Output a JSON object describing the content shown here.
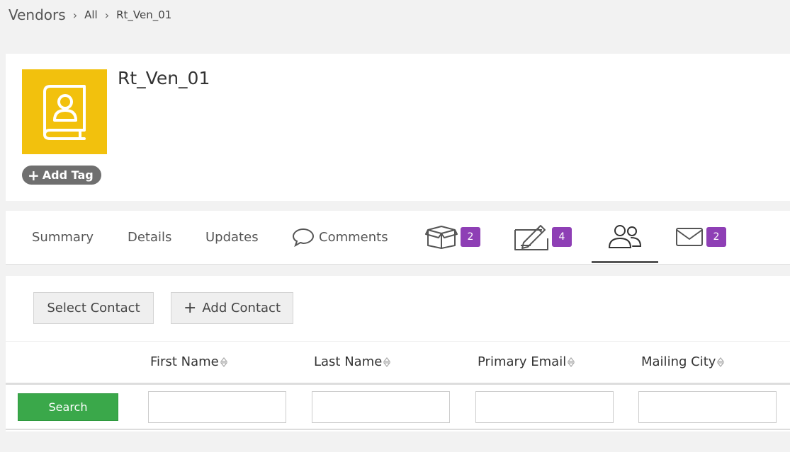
{
  "breadcrumb": {
    "root": "Vendors",
    "items": [
      "All",
      "Rt_Ven_01"
    ]
  },
  "record": {
    "title": "Rt_Ven_01",
    "avatar_color": "#f2c10d",
    "avatar_icon": "contact-book-icon",
    "add_tag_label": "Add Tag"
  },
  "tabs": [
    {
      "label": "Summary"
    },
    {
      "label": "Details"
    },
    {
      "label": "Updates"
    },
    {
      "label": "Comments",
      "icon": "comment-icon"
    },
    {
      "icon": "box-icon",
      "badge": "2"
    },
    {
      "icon": "pencil-note-icon",
      "badge": "4"
    },
    {
      "icon": "contacts-icon",
      "active": true
    },
    {
      "icon": "mail-icon",
      "badge": "2"
    }
  ],
  "actions": {
    "select_contact": "Select Contact",
    "add_contact": "Add Contact"
  },
  "table": {
    "columns": [
      "First Name",
      "Last Name",
      "Primary Email",
      "Mailing City"
    ],
    "search_label": "Search"
  },
  "colors": {
    "badge": "#8e3fb5",
    "search_button": "#3aa84a"
  }
}
